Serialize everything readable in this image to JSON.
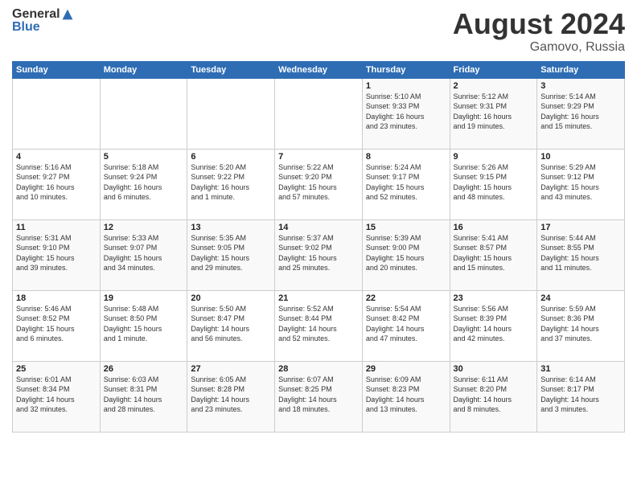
{
  "header": {
    "logo_general": "General",
    "logo_blue": "Blue",
    "title": "August 2024",
    "subtitle": "Gamovo, Russia"
  },
  "days_of_week": [
    "Sunday",
    "Monday",
    "Tuesday",
    "Wednesday",
    "Thursday",
    "Friday",
    "Saturday"
  ],
  "weeks": [
    [
      {
        "day": "",
        "info": ""
      },
      {
        "day": "",
        "info": ""
      },
      {
        "day": "",
        "info": ""
      },
      {
        "day": "",
        "info": ""
      },
      {
        "day": "1",
        "info": "Sunrise: 5:10 AM\nSunset: 9:33 PM\nDaylight: 16 hours\nand 23 minutes."
      },
      {
        "day": "2",
        "info": "Sunrise: 5:12 AM\nSunset: 9:31 PM\nDaylight: 16 hours\nand 19 minutes."
      },
      {
        "day": "3",
        "info": "Sunrise: 5:14 AM\nSunset: 9:29 PM\nDaylight: 16 hours\nand 15 minutes."
      }
    ],
    [
      {
        "day": "4",
        "info": "Sunrise: 5:16 AM\nSunset: 9:27 PM\nDaylight: 16 hours\nand 10 minutes."
      },
      {
        "day": "5",
        "info": "Sunrise: 5:18 AM\nSunset: 9:24 PM\nDaylight: 16 hours\nand 6 minutes."
      },
      {
        "day": "6",
        "info": "Sunrise: 5:20 AM\nSunset: 9:22 PM\nDaylight: 16 hours\nand 1 minute."
      },
      {
        "day": "7",
        "info": "Sunrise: 5:22 AM\nSunset: 9:20 PM\nDaylight: 15 hours\nand 57 minutes."
      },
      {
        "day": "8",
        "info": "Sunrise: 5:24 AM\nSunset: 9:17 PM\nDaylight: 15 hours\nand 52 minutes."
      },
      {
        "day": "9",
        "info": "Sunrise: 5:26 AM\nSunset: 9:15 PM\nDaylight: 15 hours\nand 48 minutes."
      },
      {
        "day": "10",
        "info": "Sunrise: 5:29 AM\nSunset: 9:12 PM\nDaylight: 15 hours\nand 43 minutes."
      }
    ],
    [
      {
        "day": "11",
        "info": "Sunrise: 5:31 AM\nSunset: 9:10 PM\nDaylight: 15 hours\nand 39 minutes."
      },
      {
        "day": "12",
        "info": "Sunrise: 5:33 AM\nSunset: 9:07 PM\nDaylight: 15 hours\nand 34 minutes."
      },
      {
        "day": "13",
        "info": "Sunrise: 5:35 AM\nSunset: 9:05 PM\nDaylight: 15 hours\nand 29 minutes."
      },
      {
        "day": "14",
        "info": "Sunrise: 5:37 AM\nSunset: 9:02 PM\nDaylight: 15 hours\nand 25 minutes."
      },
      {
        "day": "15",
        "info": "Sunrise: 5:39 AM\nSunset: 9:00 PM\nDaylight: 15 hours\nand 20 minutes."
      },
      {
        "day": "16",
        "info": "Sunrise: 5:41 AM\nSunset: 8:57 PM\nDaylight: 15 hours\nand 15 minutes."
      },
      {
        "day": "17",
        "info": "Sunrise: 5:44 AM\nSunset: 8:55 PM\nDaylight: 15 hours\nand 11 minutes."
      }
    ],
    [
      {
        "day": "18",
        "info": "Sunrise: 5:46 AM\nSunset: 8:52 PM\nDaylight: 15 hours\nand 6 minutes."
      },
      {
        "day": "19",
        "info": "Sunrise: 5:48 AM\nSunset: 8:50 PM\nDaylight: 15 hours\nand 1 minute."
      },
      {
        "day": "20",
        "info": "Sunrise: 5:50 AM\nSunset: 8:47 PM\nDaylight: 14 hours\nand 56 minutes."
      },
      {
        "day": "21",
        "info": "Sunrise: 5:52 AM\nSunset: 8:44 PM\nDaylight: 14 hours\nand 52 minutes."
      },
      {
        "day": "22",
        "info": "Sunrise: 5:54 AM\nSunset: 8:42 PM\nDaylight: 14 hours\nand 47 minutes."
      },
      {
        "day": "23",
        "info": "Sunrise: 5:56 AM\nSunset: 8:39 PM\nDaylight: 14 hours\nand 42 minutes."
      },
      {
        "day": "24",
        "info": "Sunrise: 5:59 AM\nSunset: 8:36 PM\nDaylight: 14 hours\nand 37 minutes."
      }
    ],
    [
      {
        "day": "25",
        "info": "Sunrise: 6:01 AM\nSunset: 8:34 PM\nDaylight: 14 hours\nand 32 minutes."
      },
      {
        "day": "26",
        "info": "Sunrise: 6:03 AM\nSunset: 8:31 PM\nDaylight: 14 hours\nand 28 minutes."
      },
      {
        "day": "27",
        "info": "Sunrise: 6:05 AM\nSunset: 8:28 PM\nDaylight: 14 hours\nand 23 minutes."
      },
      {
        "day": "28",
        "info": "Sunrise: 6:07 AM\nSunset: 8:25 PM\nDaylight: 14 hours\nand 18 minutes."
      },
      {
        "day": "29",
        "info": "Sunrise: 6:09 AM\nSunset: 8:23 PM\nDaylight: 14 hours\nand 13 minutes."
      },
      {
        "day": "30",
        "info": "Sunrise: 6:11 AM\nSunset: 8:20 PM\nDaylight: 14 hours\nand 8 minutes."
      },
      {
        "day": "31",
        "info": "Sunrise: 6:14 AM\nSunset: 8:17 PM\nDaylight: 14 hours\nand 3 minutes."
      }
    ]
  ]
}
